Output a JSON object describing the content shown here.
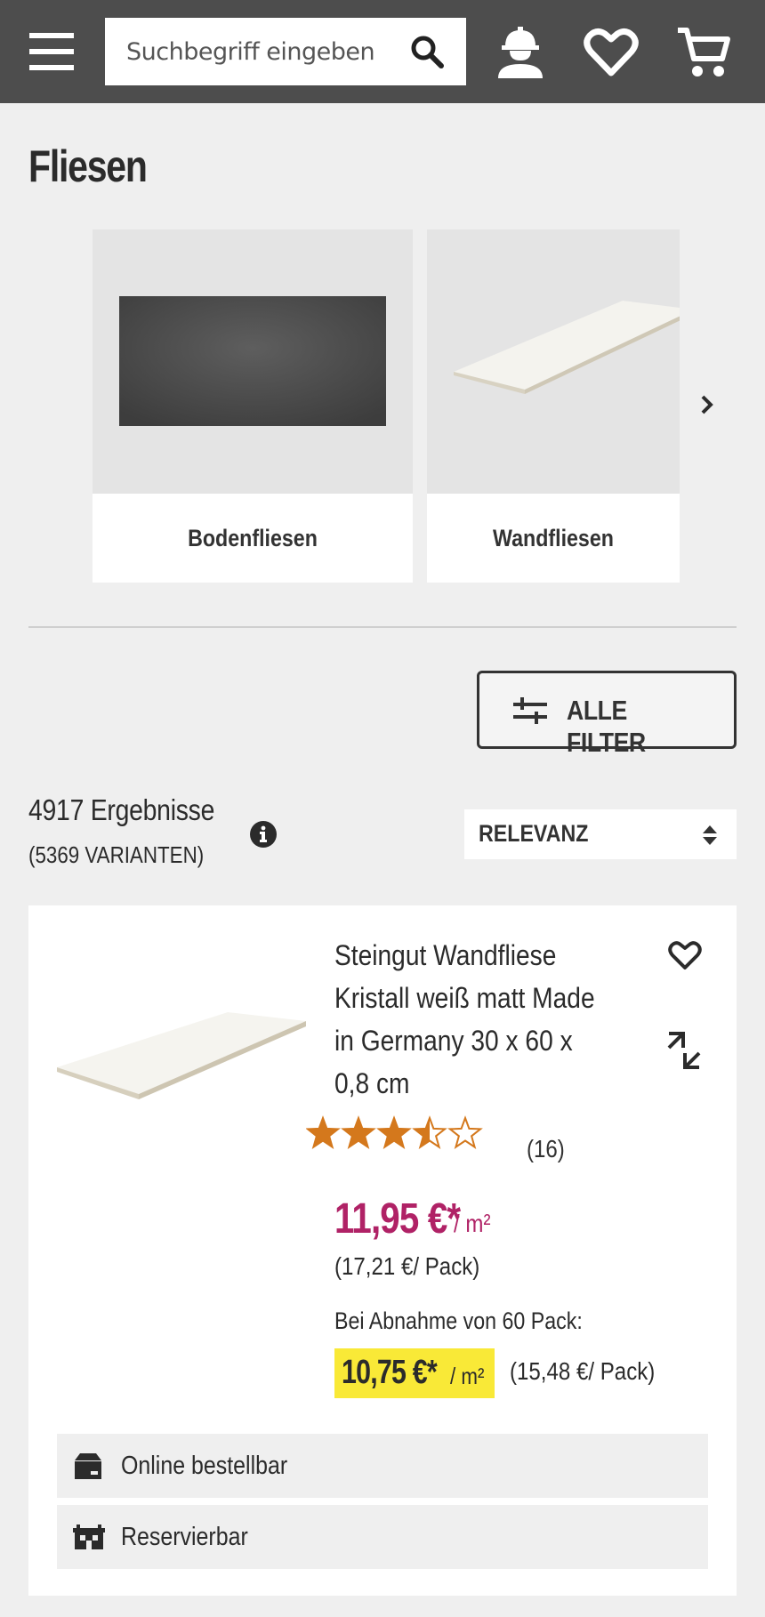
{
  "header": {
    "search_placeholder": "Suchbegriff eingeben",
    "icons": [
      "menu-icon",
      "search-icon",
      "account-worker-icon",
      "heart-icon",
      "cart-icon"
    ],
    "background_color": "#4d4d4d"
  },
  "page": {
    "title": "Fliesen"
  },
  "categories": [
    {
      "label": "Bodenfliesen"
    },
    {
      "label": "Wandfliesen"
    }
  ],
  "filters": {
    "all_filters_label": "ALLE FILTER"
  },
  "results": {
    "count_label": "4917 Ergebnisse",
    "variants_label": "(5369 VARIANTEN)",
    "sort_value": "RELEVANZ"
  },
  "product": {
    "title": "Steingut Wandfliese Kristall weiß matt Made in Germany 30 x 60 x 0,8 cm",
    "rating": 3.5,
    "rating_max": 5,
    "rating_count": "(16)",
    "price": "11,95 €*",
    "price_unit": "/ m²",
    "price_per_pack": "(17,21 €/ Pack)",
    "bulk_label": "Bei Abnahme von 60 Pack:",
    "bulk_price": "10,75 €*",
    "bulk_unit": "/ m²",
    "bulk_per_pack": "(15,48 €/ Pack)",
    "availability": [
      {
        "label": "Online bestellbar",
        "icon": "parcel-icon"
      },
      {
        "label": "Reservierbar",
        "icon": "store-icon"
      }
    ],
    "colors": {
      "price": "#b02266",
      "bulk_highlight": "#f9e937",
      "stars": "#d4781c"
    }
  }
}
